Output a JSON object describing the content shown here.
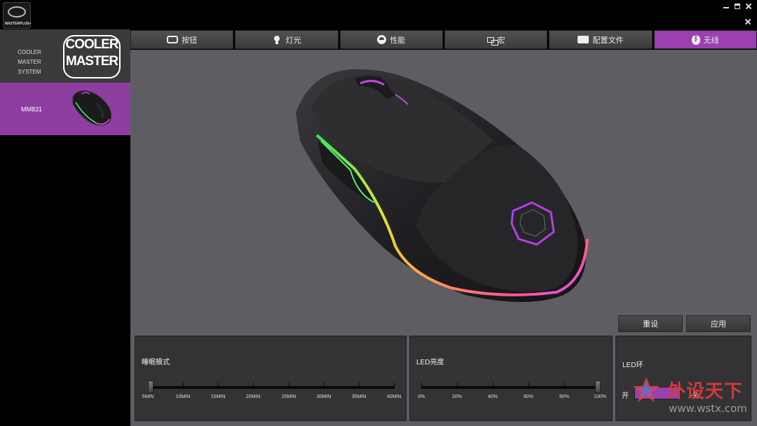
{
  "app": {
    "logo_text": "MASTERPLUS+"
  },
  "sidebar": {
    "system_label": "COOLER MASTER SYSTEM",
    "brand_logo_line1": "COOLER",
    "brand_logo_line2": "MASTER",
    "device": {
      "name": "MM831",
      "selected": true
    }
  },
  "tabs": [
    {
      "label": "按钮",
      "icon": "keyboard-icon",
      "active": false
    },
    {
      "label": "灯光",
      "icon": "lightbulb-icon",
      "active": false
    },
    {
      "label": "性能",
      "icon": "gauge-icon",
      "active": false
    },
    {
      "label": "宏",
      "icon": "macro-icon",
      "active": false
    },
    {
      "label": "配置文件",
      "icon": "profile-file-icon",
      "active": false
    },
    {
      "label": "无线",
      "icon": "bluetooth-icon",
      "active": true
    }
  ],
  "actions": {
    "reset_label": "重设",
    "apply_label": "应用"
  },
  "sleep_mode": {
    "title": "睡眠模式",
    "ticks": [
      "5MIN",
      "10MIN",
      "15MIN",
      "20MIN",
      "25MIN",
      "30MIN",
      "35MIN",
      "40MIN"
    ],
    "selected": "5MIN"
  },
  "led_brightness": {
    "title": "LED亮度",
    "ticks": [
      "0%",
      "20%",
      "40%",
      "60%",
      "80%",
      "100%"
    ],
    "selected": "100%"
  },
  "led_ring": {
    "title": "LED环",
    "on_label": "开",
    "off_label": "关"
  },
  "watermark": {
    "title": "外设天下",
    "url": "www.wstx.com"
  },
  "colors": {
    "accent": "#9b3fb1",
    "panel": "#333336",
    "main_bg": "#5d5d62"
  }
}
